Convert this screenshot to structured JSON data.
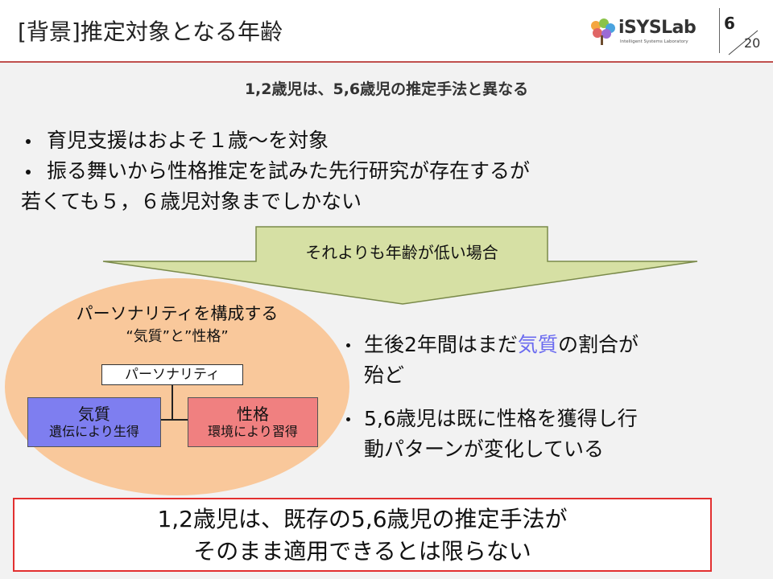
{
  "header": {
    "title": "[背景]推定対象となる年齢",
    "logo_text": "iSYSLab",
    "logo_sub": "Intelligent Systems Laboratory",
    "page_current": "6",
    "page_total": "20"
  },
  "subtitle": "1,2歳児は、5,6歳児の推定手法と異なる",
  "bullets": [
    "育児支援はおよそ１歳～を対象",
    "振る舞いから性格推定を試みた先行研究が存在するが",
    "若くても５，６歳児対象までしかない"
  ],
  "arrow_label": "それよりも年齢が低い場合",
  "personality": {
    "title": "パーソナリティを構成する",
    "subtitle": "“気質”と”性格”",
    "root": "パーソナリティ",
    "temperament": {
      "label": "気質",
      "sub": "遺伝により生得"
    },
    "character": {
      "label": "性格",
      "sub": "環境により習得"
    }
  },
  "right_bullets": [
    {
      "pre": "生後2年間はまだ",
      "hl": "気質",
      "post": "の割合が",
      "line2": "殆ど"
    },
    {
      "line1": "5,6歳児は既に性格を獲得し行",
      "line2": "動パターンが変化している"
    }
  ],
  "conclusion": {
    "line1": "1,2歳児は、既存の5,6歳児の推定手法が",
    "line2": "そのまま適用できるとは限らない"
  },
  "colors": {
    "accent_line": "#c0504d",
    "arrow_fill": "#d6e0a4",
    "ellipse_fill": "#f9c89b",
    "temperament_fill": "#7e7ef0",
    "character_fill": "#f08080",
    "highlight": "#6b6bf0",
    "conclusion_border": "#e23030"
  }
}
